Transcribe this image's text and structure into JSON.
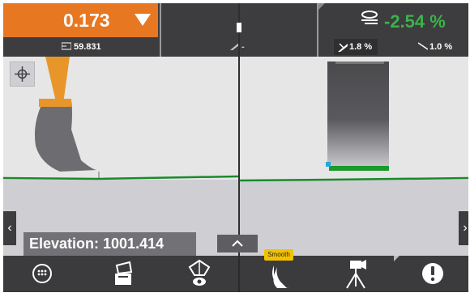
{
  "top": {
    "cut_value": "0.173",
    "secondary_value": "59.831",
    "center_value": "-",
    "slope_percent": "-2.54 %",
    "cross_slope": "1.8 %",
    "main_slope": "1.0 %"
  },
  "elevation_label": "Elevation: 1001.414",
  "smooth_label": "Smooth",
  "colors": {
    "accent_orange": "#e87722",
    "slope_green": "#3bb34a",
    "guide_line_green": "#1a8a2a"
  },
  "icons": {
    "top_down_arrow": "triangle-down-icon",
    "crosshair": "crosshair-icon",
    "left_arrow": "chevron-left-icon",
    "right_arrow": "chevron-right-icon",
    "expand_up": "chevron-up-icon",
    "menu": "menu-grid-icon",
    "bucket_settings": "bucket-settings-icon",
    "view": "view-eye-icon",
    "bucket_smooth": "bucket-smooth-icon",
    "camera_tripod": "camera-tripod-icon",
    "alert": "alert-icon"
  }
}
